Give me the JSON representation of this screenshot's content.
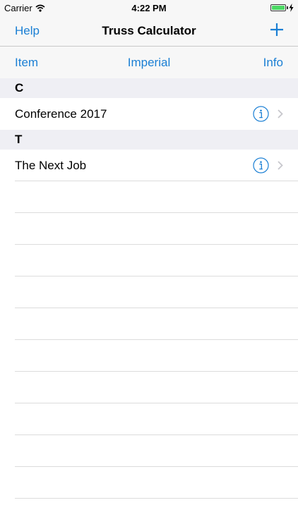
{
  "status_bar": {
    "carrier": "Carrier",
    "time": "4:22 PM",
    "battery_level": 1.0
  },
  "nav": {
    "left_label": "Help",
    "title": "Truss Calculator",
    "add_icon": "plus-icon"
  },
  "toolbar": {
    "left_label": "Item",
    "center_label": "Imperial",
    "right_label": "Info"
  },
  "sections": [
    {
      "header": "C",
      "rows": [
        {
          "label": "Conference 2017"
        }
      ]
    },
    {
      "header": "T",
      "rows": [
        {
          "label": "The Next Job"
        }
      ]
    }
  ],
  "colors": {
    "accent": "#1a7fd4",
    "battery": "#4cd964",
    "bar_bg": "#f7f7f7",
    "section_bg": "#efeff4"
  }
}
